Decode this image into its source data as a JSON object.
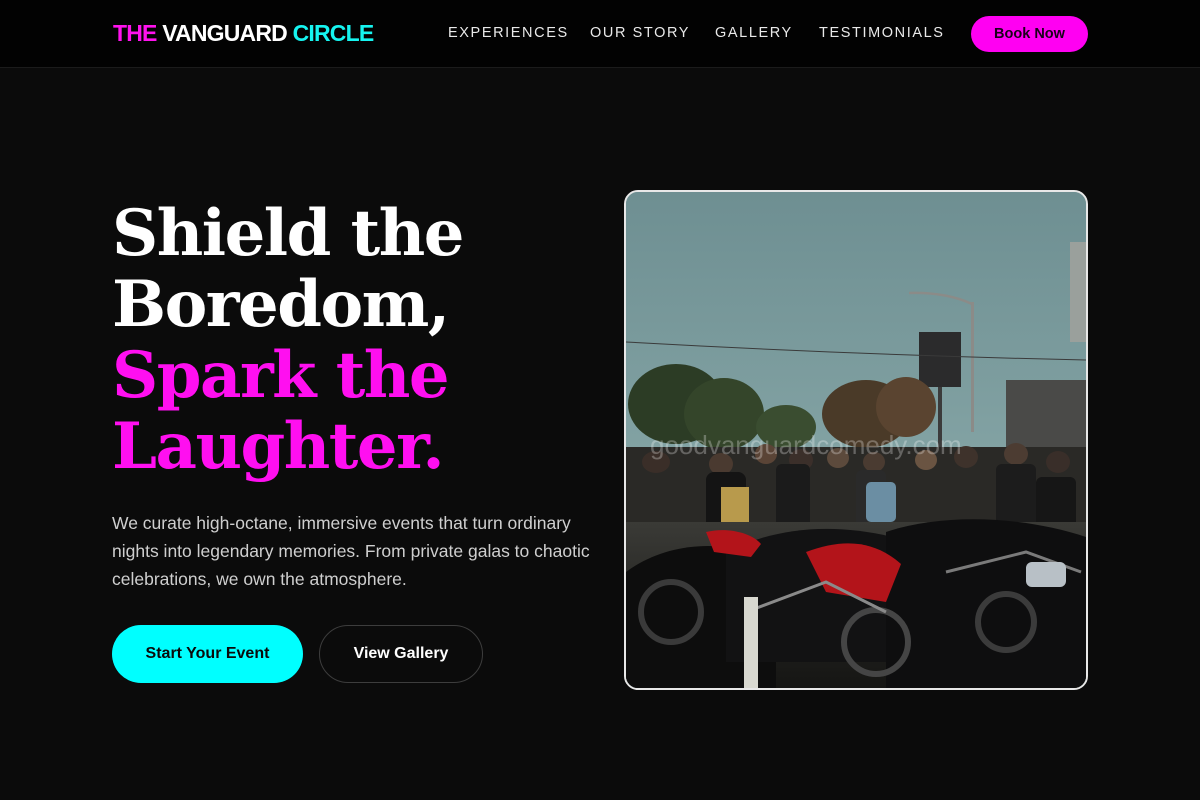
{
  "brand": {
    "part1": "THE",
    "part2": "VANGUARD",
    "part3": "CIRCLE",
    "colors": {
      "pink": "#ff00f2",
      "cyan": "#00ffff",
      "white": "#ffffff"
    }
  },
  "nav": {
    "links": [
      "EXPERIENCES",
      "OUR STORY",
      "GALLERY",
      "TESTIMONIALS"
    ],
    "cta": "Book Now"
  },
  "hero": {
    "headline_line1": "Shield the",
    "headline_line2": "Boredom,",
    "headline_line3": "Spark the",
    "headline_line4": "Laughter.",
    "description": "We curate high-octane, immersive events that turn ordinary nights into legendary memories. From private galas to chaotic celebrations, we own the atmosphere.",
    "primary_cta": "Start Your Event",
    "secondary_cta": "View Gallery"
  },
  "image": {
    "subject": "crowd-with-motorcycles-photo",
    "watermark": "goodvanguardcomedy.com"
  }
}
